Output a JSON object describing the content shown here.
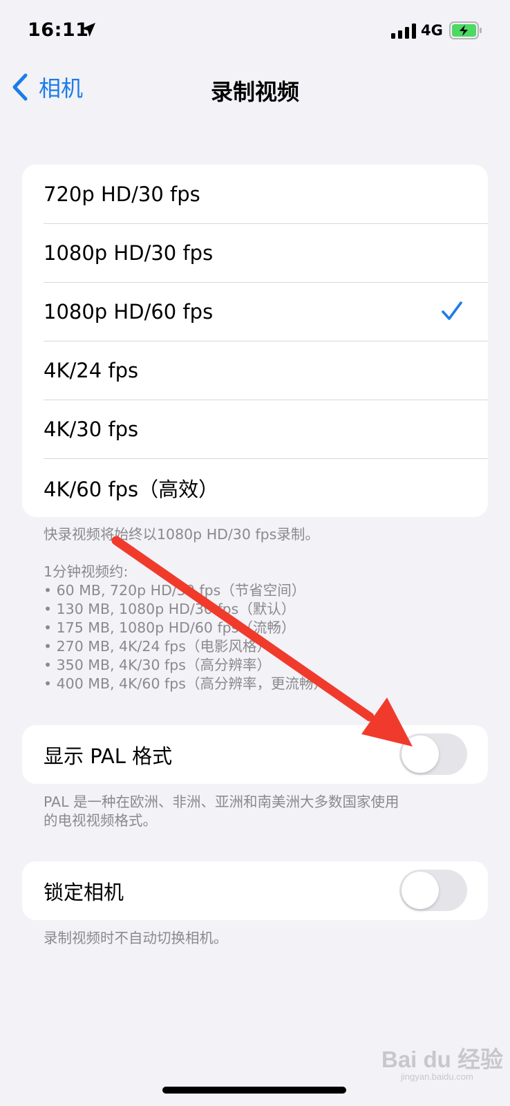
{
  "status_bar": {
    "time": "16:11",
    "network": "4G",
    "icons": [
      "location-arrow-icon",
      "signal-bars-icon",
      "battery-charging-icon"
    ]
  },
  "nav": {
    "back_label": "相机",
    "title": "录制视频",
    "accent_color": "#1c7ce8"
  },
  "video_formats": [
    {
      "label": "720p HD/30 fps",
      "selected": false
    },
    {
      "label": "1080p HD/30 fps",
      "selected": false
    },
    {
      "label": "1080p HD/60 fps",
      "selected": true
    },
    {
      "label": "4K/24 fps",
      "selected": false
    },
    {
      "label": "4K/30 fps",
      "selected": false
    },
    {
      "label": "4K/60 fps（高效）",
      "selected": false
    }
  ],
  "format_notes": {
    "quicktake": "快录视频将始终以1080p HD/30 fps录制。",
    "size_heading": "1分钟视频约:",
    "size_items": [
      "• 60 MB, 720p HD/30 fps（节省空间）",
      "• 130 MB, 1080p HD/30 fps（默认）",
      "• 175 MB, 1080p HD/60 fps（流畅）",
      "• 270 MB, 4K/24 fps（电影风格）",
      "• 350 MB, 4K/30 fps（高分辨率）",
      "• 400 MB, 4K/60 fps（高分辨率，更流畅）"
    ]
  },
  "pal": {
    "label": "显示 PAL 格式",
    "enabled": false,
    "footnote_lines": [
      "PAL 是一种在欧洲、非洲、亚洲和南美洲大多数国家使用",
      "的电视视频格式。"
    ]
  },
  "lock_camera": {
    "label": "锁定相机",
    "enabled": false,
    "footnote": "录制视频时不自动切换相机。"
  },
  "annotation_arrow_color": "#f03b2c",
  "watermark": {
    "brand": "Bai du 经验",
    "url": "jingyan.baidu.com"
  }
}
